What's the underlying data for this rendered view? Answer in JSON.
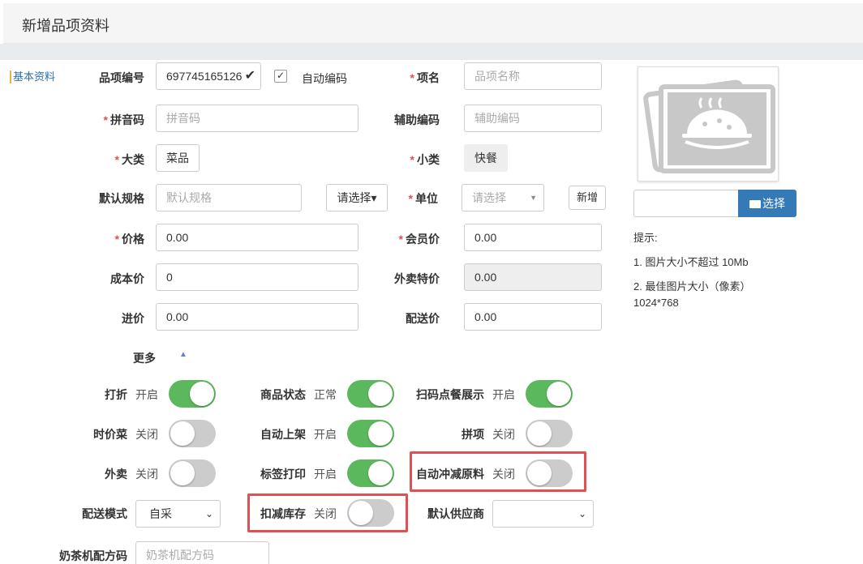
{
  "header": {
    "title": "新增品项资料"
  },
  "side": {
    "link": "基本资料"
  },
  "form": {
    "code_label": "品项编号",
    "code_value": "697745165126",
    "auto_code_label": "自动编码",
    "name_label": "项名",
    "name_placeholder": "品项名称",
    "pinyin_label": "拼音码",
    "pinyin_placeholder": "拼音码",
    "aux_label": "辅助编码",
    "aux_placeholder": "辅助编码",
    "category_label": "大类",
    "category_value": "菜品",
    "subcategory_label": "小类",
    "subcategory_value": "快餐",
    "spec_label": "默认规格",
    "spec_placeholder": "默认规格",
    "spec_choose": "请选择▾",
    "unit_label": "单位",
    "unit_placeholder": "请选择",
    "unit_add": "新增",
    "price_label": "价格",
    "price_value": "0.00",
    "member_price_label": "会员价",
    "member_price_value": "0.00",
    "cost_label": "成本价",
    "cost_value": "0",
    "takeout_price_label": "外卖特价",
    "takeout_price_value": "0.00",
    "purchase_label": "进价",
    "purchase_value": "0.00",
    "delivery_price_label": "配送价",
    "delivery_price_value": "0.00",
    "more_label": "更多",
    "more_arrow": "▲"
  },
  "toggles": {
    "discount": {
      "label": "打折",
      "state": "开启"
    },
    "status": {
      "label": "商品状态",
      "state": "正常"
    },
    "scan_show": {
      "label": "扫码点餐展示",
      "state": "开启"
    },
    "seasonal": {
      "label": "时价菜",
      "state": "关闭"
    },
    "auto_shelf": {
      "label": "自动上架",
      "state": "开启"
    },
    "combo": {
      "label": "拼项",
      "state": "关闭"
    },
    "takeout": {
      "label": "外卖",
      "state": "关闭"
    },
    "label_print": {
      "label": "标签打印",
      "state": "开启"
    },
    "auto_deduct": {
      "label": "自动冲减原料",
      "state": "关闭"
    },
    "stock_deduct": {
      "label": "扣减库存",
      "state": "关闭"
    }
  },
  "delivery": {
    "mode_label": "配送模式",
    "mode_value": "自采",
    "supplier_label": "默认供应商",
    "supplier_value": ""
  },
  "milktea": {
    "label": "奶茶机配方码",
    "placeholder": "奶茶机配方码"
  },
  "image": {
    "choose_label": "选择",
    "tip_title": "提示:",
    "tip1": "1. 图片大小不超过 10Mb",
    "tip2": "2. 最佳图片大小（像素）",
    "tip3": "1024*768"
  },
  "colors": {
    "switch_on": "#5cb85c",
    "switch_off": "#cccccc",
    "primary": "#337ab7",
    "required": "#d9534f",
    "highlight": "#e05050"
  }
}
